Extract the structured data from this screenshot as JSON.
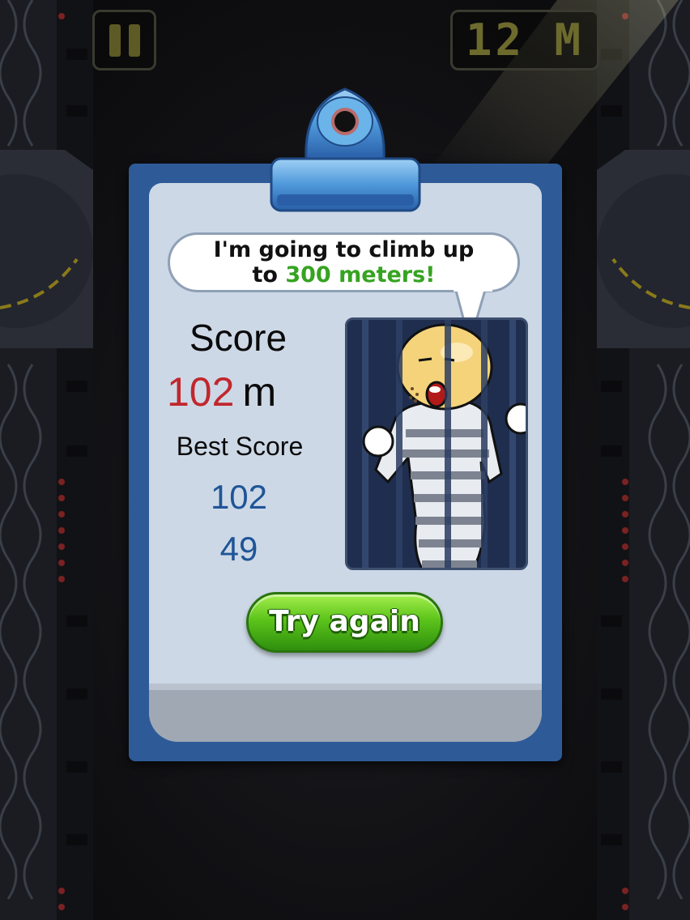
{
  "hud": {
    "pause_icon": "pause-icon",
    "distance": "12 M"
  },
  "speech": {
    "line1": "I'm going to climb up",
    "line2_prefix": "to ",
    "line2_highlight": "300 meters!"
  },
  "score": {
    "label": "Score",
    "value": "102",
    "unit": "m"
  },
  "best": {
    "label": "Best Score",
    "first": "102",
    "second": "49"
  },
  "button": {
    "try_again": "Try again"
  },
  "colors": {
    "board": "#2e5b97",
    "paper": "#cdd8e6",
    "score_value": "#c1272d",
    "best_values": "#1f5597",
    "button_green": "#5cc41a",
    "highlight_green": "#36a321"
  }
}
